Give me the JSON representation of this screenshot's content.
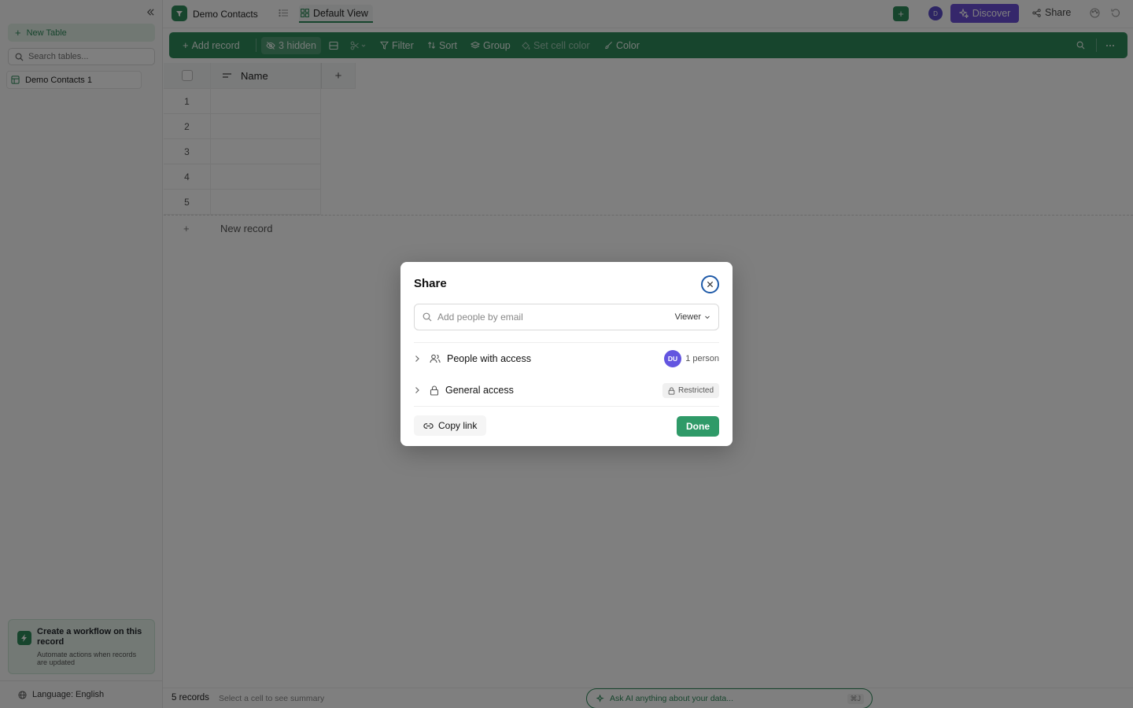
{
  "sidebar": {
    "new_table_label": "New Table",
    "search_placeholder": "Search tables...",
    "tables": [
      "Demo Contacts 1"
    ],
    "workflow_card": {
      "title": "Create a workflow on this record",
      "description": "Automate actions when records are updated"
    },
    "language_label": "Language: English"
  },
  "topbar": {
    "app_title": "Demo Contacts",
    "view_tab_label": "Default View",
    "avatar_initial": "D",
    "discover_label": "Discover",
    "share_label": "Share"
  },
  "toolbar": {
    "add_record": "Add record",
    "hidden_fields": "3 hidden",
    "filter": "Filter",
    "sort": "Sort",
    "group": "Group",
    "set_cell_color": "Set cell color",
    "color": "Color"
  },
  "grid": {
    "columns": [
      "Name"
    ],
    "row_numbers": [
      "1",
      "2",
      "3",
      "4",
      "5"
    ],
    "add_column_label": "+",
    "new_record_label": "New record",
    "new_record_plus": "+"
  },
  "footer": {
    "record_count": "5 records",
    "summary_hint": "Select a cell to see summary",
    "ask_ai_label": "Ask AI anything about your data...",
    "ask_ai_shortcut": "⌘J"
  },
  "share_dialog": {
    "title": "Share",
    "email_placeholder": "Add people by email",
    "role_value": "Viewer",
    "people_with_access_label": "People with access",
    "people_avatar_initials": "DU",
    "people_count": "1 person",
    "general_access_label": "General access",
    "general_access_value": "Restricted",
    "copy_link_label": "Copy link",
    "done_label": "Done"
  },
  "colors": {
    "brand_green": "#2f8a5b",
    "discover_purple": "#6b4fd6",
    "avatar_purple": "#6355e0",
    "focus_ring": "#1f5aa8"
  }
}
